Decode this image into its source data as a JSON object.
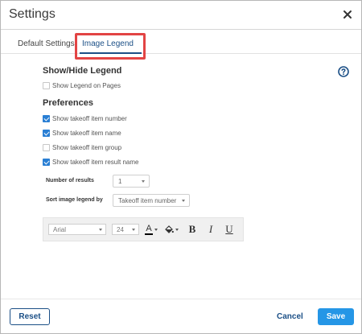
{
  "dialog": {
    "title": "Settings"
  },
  "tabs": [
    {
      "label": "Default Settings",
      "active": false
    },
    {
      "label": "Image Legend",
      "active": true
    }
  ],
  "colors": {
    "accent": "#1b4f86",
    "primary_button": "#2596e6",
    "checkbox_checked": "#2a7fd4",
    "highlight": "#e24444"
  },
  "show_hide": {
    "heading": "Show/Hide Legend",
    "option": {
      "label": "Show Legend on Pages",
      "checked": false
    }
  },
  "preferences": {
    "heading": "Preferences",
    "options": [
      {
        "label": "Show takeoff item number",
        "checked": true
      },
      {
        "label": "Show takeoff item name",
        "checked": true
      },
      {
        "label": "Show takeoff item group",
        "checked": false
      },
      {
        "label": "Show takeoff item result name",
        "checked": true
      }
    ],
    "number_of_results_label": "Number of results",
    "number_of_results_value": "1",
    "sort_label": "Sort image legend by",
    "sort_value": "Takeoff item number"
  },
  "format": {
    "font_value": "Arial",
    "size_value": "24",
    "font_color_letter": "A",
    "font_color": "#000000",
    "bold_label": "B",
    "italic_label": "I",
    "underline_label": "U"
  },
  "footer": {
    "reset_label": "Reset",
    "cancel_label": "Cancel",
    "save_label": "Save"
  },
  "icons": [
    "close-icon",
    "help-icon",
    "font-color-icon",
    "fill-color-icon",
    "chevron-down-icon"
  ]
}
